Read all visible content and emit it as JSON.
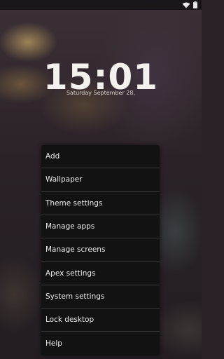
{
  "clock": {
    "time": "15:01",
    "date": "Saturday September 28,"
  },
  "menu": {
    "items": [
      {
        "label": "Add"
      },
      {
        "label": "Wallpaper"
      },
      {
        "label": "Theme settings"
      },
      {
        "label": "Manage apps"
      },
      {
        "label": "Manage screens"
      },
      {
        "label": "Apex settings"
      },
      {
        "label": "System settings"
      },
      {
        "label": "Lock desktop"
      },
      {
        "label": "Help"
      }
    ]
  },
  "status": {
    "icons": [
      "wifi-icon",
      "battery-icon"
    ]
  },
  "colors": {
    "menu_bg": "#121212",
    "text": "#ececec"
  }
}
